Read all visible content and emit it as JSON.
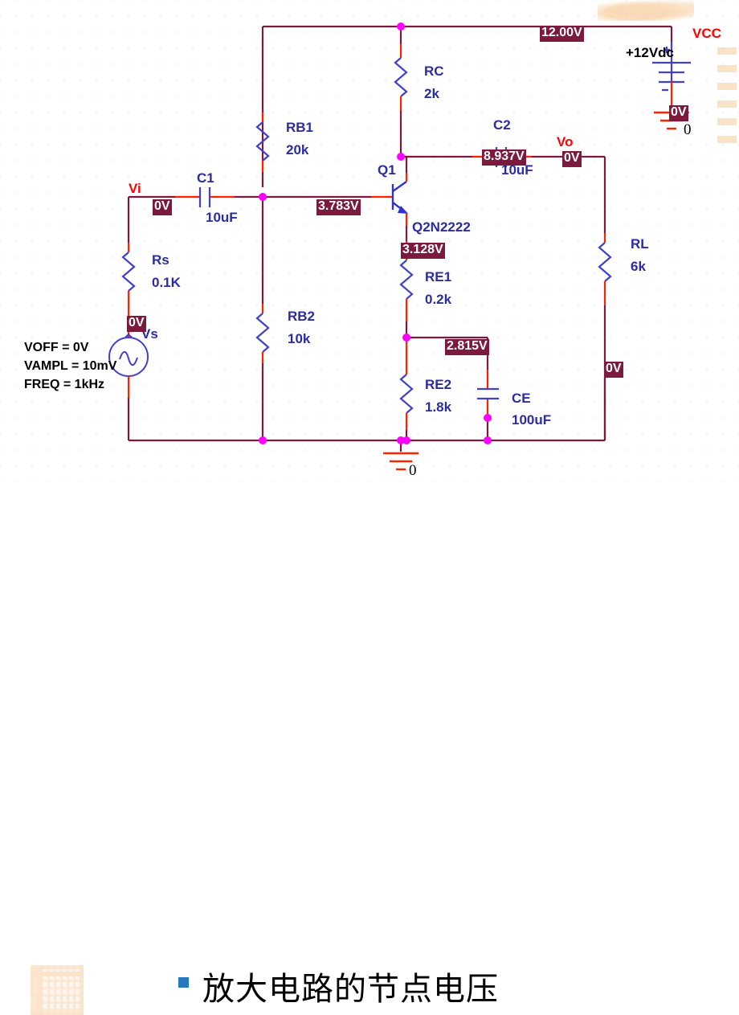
{
  "page": {
    "background": "#ffffff",
    "wire_color": "#7b1a3c",
    "pin_color": "#ff2200",
    "junction_color": "#ff00ff",
    "symbol_color": "#3333cc",
    "ref_color": "#2c2c9c",
    "net_color": "#ff0000",
    "vbox_bg": "#7b1a3c",
    "vbox_fg": "#ffffff",
    "bullet_color": "#2878be"
  },
  "caption": {
    "bullet": "square-bullet",
    "text": "放大电路的节点电压"
  },
  "components": [
    {
      "id": "RB1",
      "type": "resistor",
      "ref": "RB1",
      "value": "20k"
    },
    {
      "id": "RB2",
      "type": "resistor",
      "ref": "RB2",
      "value": "10k"
    },
    {
      "id": "RC",
      "type": "resistor",
      "ref": "RC",
      "value": "2k"
    },
    {
      "id": "RE1",
      "type": "resistor",
      "ref": "RE1",
      "value": "0.2k"
    },
    {
      "id": "RE2",
      "type": "resistor",
      "ref": "RE2",
      "value": "1.8k"
    },
    {
      "id": "RL",
      "type": "resistor",
      "ref": "RL",
      "value": "6k"
    },
    {
      "id": "Rs",
      "type": "resistor",
      "ref": "Rs",
      "value": "0.1K"
    },
    {
      "id": "C1",
      "type": "capacitor",
      "ref": "C1",
      "value": "10uF"
    },
    {
      "id": "C2",
      "type": "capacitor",
      "ref": "C2",
      "value": "10uF"
    },
    {
      "id": "CE",
      "type": "capacitor",
      "ref": "CE",
      "value": "100uF"
    },
    {
      "id": "Q1",
      "type": "npn-transistor",
      "ref": "Q1",
      "value": "Q2N2222"
    },
    {
      "id": "VCC",
      "type": "dc-source",
      "ref": "VCC",
      "value": "+12Vdc"
    },
    {
      "id": "Vs",
      "type": "vsin-source",
      "ref": "Vs",
      "value": ""
    }
  ],
  "source_params": {
    "voff": "VOFF = 0V",
    "vampl": "VAMPL = 10mV",
    "freq": "FREQ = 1kHz"
  },
  "net_labels": [
    {
      "id": "Vi",
      "text": "Vi"
    },
    {
      "id": "Vo",
      "text": "Vo"
    },
    {
      "id": "VCC",
      "text": "VCC"
    }
  ],
  "ground_labels": [
    {
      "id": "gnd-vcc",
      "text": "0"
    },
    {
      "id": "gnd-main",
      "text": "0"
    }
  ],
  "bias_points": [
    {
      "id": "v-vcc-rail",
      "node": "VCC rail",
      "value": "12.00V"
    },
    {
      "id": "v-collector",
      "node": "Q1 collector",
      "value": "8.937V"
    },
    {
      "id": "v-base",
      "node": "Q1 base",
      "value": "3.783V"
    },
    {
      "id": "v-emitter",
      "node": "Q1 emitter",
      "value": "3.128V"
    },
    {
      "id": "v-re1-re2",
      "node": "RE1/RE2 node",
      "value": "2.815V"
    },
    {
      "id": "v-vi",
      "node": "Vi input",
      "value": "0V"
    },
    {
      "id": "v-vo",
      "node": "Vo output",
      "value": "0V"
    },
    {
      "id": "v-vs",
      "node": "Vs source",
      "value": "0V"
    },
    {
      "id": "v-vcc-gnd",
      "node": "VCC ground",
      "value": "0V"
    },
    {
      "id": "v-rl",
      "node": "RL branch",
      "value": "0V"
    }
  ]
}
